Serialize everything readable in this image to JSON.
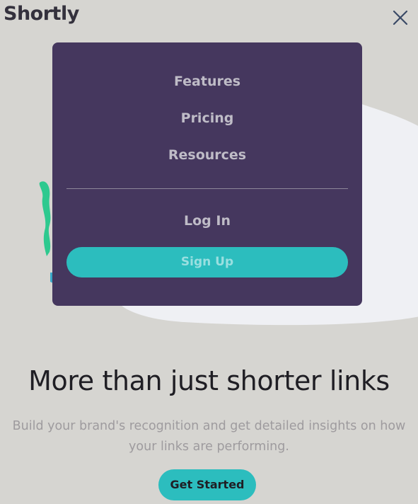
{
  "header": {
    "logo": "Shortly",
    "close_icon": "close-icon"
  },
  "menu": {
    "links": [
      {
        "label": "Features"
      },
      {
        "label": "Pricing"
      },
      {
        "label": "Resources"
      }
    ],
    "login_label": "Log In",
    "signup_label": "Sign Up"
  },
  "hero": {
    "headline": "More than just shorter links",
    "subtext_line1": "Build your brand's recognition and get detailed insights on how",
    "subtext_line2": "your links are performing.",
    "cta_label": "Get Started"
  },
  "colors": {
    "background": "#d6d5d1",
    "menu_bg": "#45375e",
    "accent": "#2cbdbe",
    "text_dark": "#34313d",
    "menu_text": "#bfbcc7"
  }
}
